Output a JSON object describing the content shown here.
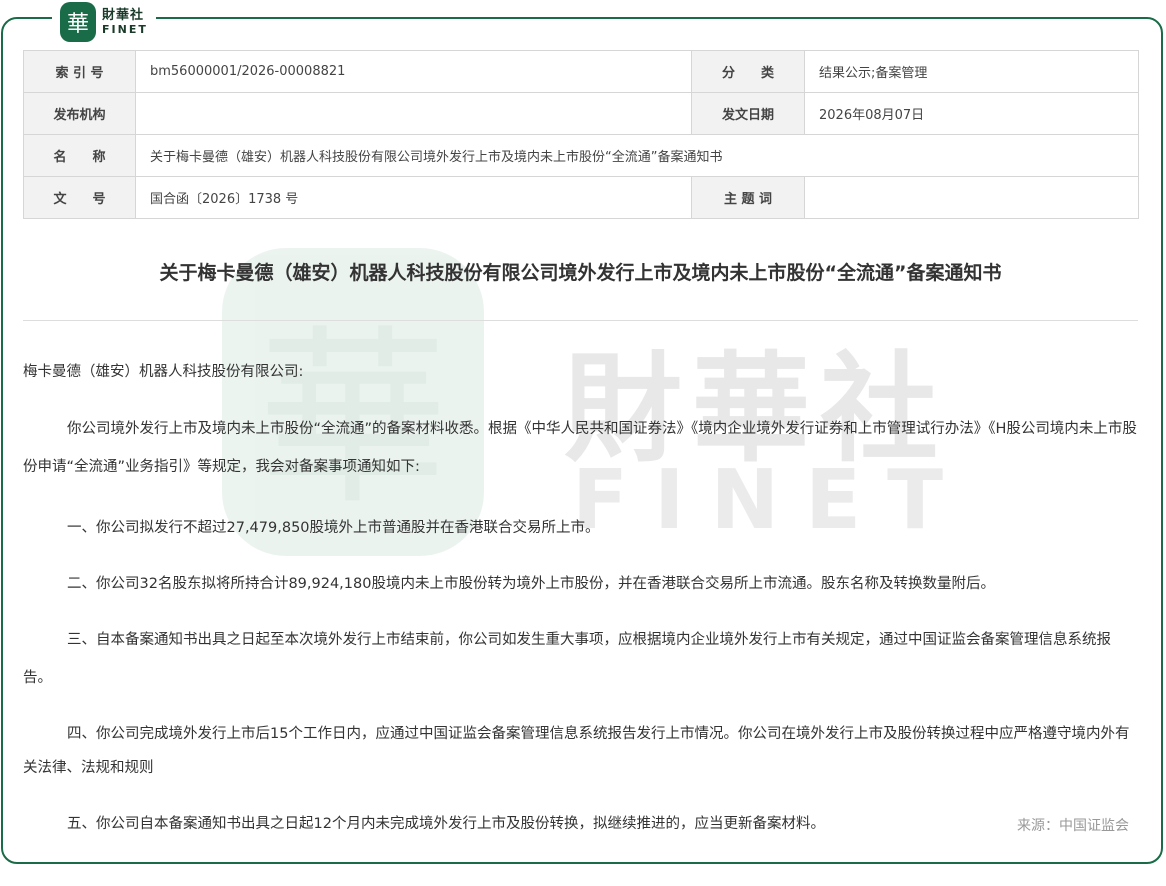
{
  "brand": {
    "mark_char": "華",
    "name_cn": "財華社",
    "name_en": "FINET",
    "accent": "#1a6b47"
  },
  "meta": {
    "index_label": "索 引 号",
    "index_value": "bm56000001/2026-00008821",
    "category_label": "分　　类",
    "category_value": "结果公示;备案管理",
    "issuer_label": "发布机构",
    "issuer_value": "",
    "date_label": "发文日期",
    "date_value": "2026年08月07日",
    "name_label": "名　　称",
    "name_value": "关于梅卡曼德（雄安）机器人科技股份有限公司境外发行上市及境内未上市股份“全流通”备案通知书",
    "docno_label": "文　　号",
    "docno_value": "国合函〔2026〕1738 号",
    "keywords_label": "主 题 词",
    "keywords_value": ""
  },
  "title": "关于梅卡曼德（雄安）机器人科技股份有限公司境外发行上市及境内未上市股份“全流通”备案通知书",
  "salutation": "梅卡曼德（雄安）机器人科技股份有限公司:",
  "paragraphs": {
    "intro": "你公司境外发行上市及境内未上市股份“全流通”的备案材料收悉。根据《中华人民共和国证券法》《境内企业境外发行证券和上市管理试行办法》《H股公司境内未上市股份申请“全流通”业务指引》等规定，我会对备案事项通知如下:",
    "p1": "一、你公司拟发行不超过27,479,850股境外上市普通股并在香港联合交易所上市。",
    "p2": "二、你公司32名股东拟将所持合计89,924,180股境内未上市股份转为境外上市股份，并在香港联合交易所上市流通。股东名称及转换数量附后。",
    "p3": "三、自本备案通知书出具之日起至本次境外发行上市结束前，你公司如发生重大事项，应根据境内企业境外发行上市有关规定，通过中国证监会备案管理信息系统报告。",
    "p4": "四、你公司完成境外发行上市后15个工作日内，应通过中国证监会备案管理信息系统报告发行上市情况。你公司在境外发行上市及股份转换过程中应严格遵守境内外有关法律、法规和规则",
    "p5": "五、你公司自本备案通知书出具之日起12个月内未完成境外发行上市及股份转换，拟继续推进的，应当更新备案材料。"
  },
  "source": "来源：中国证监会"
}
